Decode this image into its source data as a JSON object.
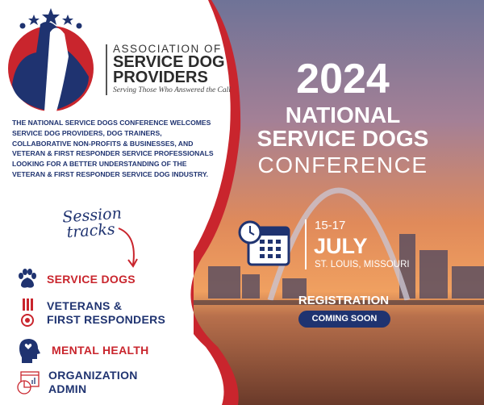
{
  "colors": {
    "navy": "#1f3370",
    "red": "#c9252d",
    "sky_top": "#6f7397",
    "sunset": "#e9874f"
  },
  "logo": {
    "line1": "ASSOCIATION OF",
    "line2": "SERVICE DOG",
    "line3": "PROVIDERS",
    "tagline": "Serving Those Who Answered the Call"
  },
  "intro": "THE NATIONAL SERVICE DOGS CONFERENCE WELCOMES SERVICE DOG PROVIDERS, DOG TRAINERS, COLLABORATIVE NON-PROFITS & BUSINESSES, AND VETERAN & FIRST RESPONDER SERVICE PROFESSIONALS LOOKING FOR A BETTER UNDERSTANDING OF THE VETERAN & FIRST RESPONDER SERVICE DOG INDUSTRY.",
  "session": {
    "line1": "Session",
    "line2": "tracks"
  },
  "tracks": [
    {
      "label": "SERVICE DOGS",
      "icon": "paw-icon"
    },
    {
      "label": "VETERANS &",
      "label2": "FIRST RESPONDERS",
      "icon": "medal-icon"
    },
    {
      "label": "MENTAL HEALTH",
      "icon": "head-heart-icon"
    },
    {
      "label": "ORGANIZATION",
      "label2": "ADMIN",
      "icon": "chart-icon"
    }
  ],
  "headline": {
    "year": "2024",
    "line1": "NATIONAL",
    "line2": "SERVICE DOGS",
    "line3": "CONFERENCE"
  },
  "event": {
    "dates": "15-17",
    "month": "JULY",
    "location": "ST. LOUIS, MISSOURI",
    "icon": "calendar-clock-icon"
  },
  "registration": {
    "label": "REGISTRATION",
    "status": "COMING SOON"
  }
}
